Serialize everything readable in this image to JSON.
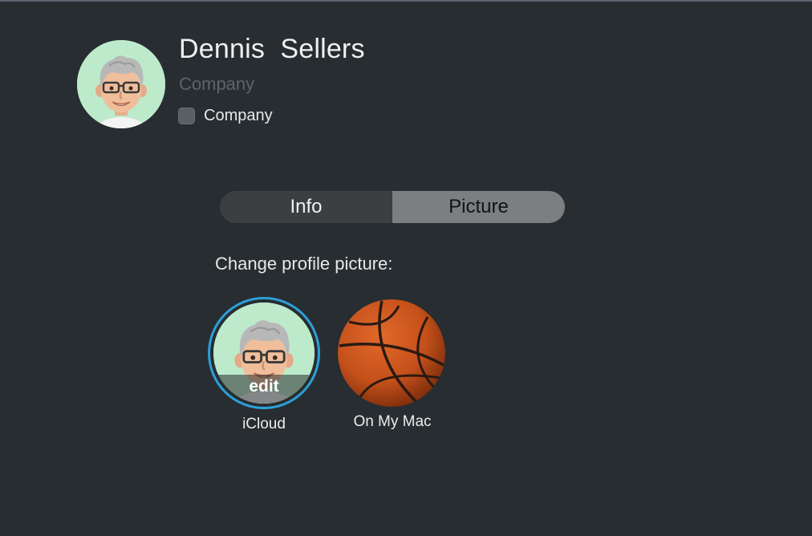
{
  "contact": {
    "first_name": "Dennis",
    "last_name": "Sellers",
    "full_name": "Dennis  Sellers",
    "company_placeholder": "Company",
    "company_checkbox_label": "Company",
    "company_checked": false
  },
  "tabs": [
    {
      "label": "Info",
      "active": false
    },
    {
      "label": "Picture",
      "active": true
    }
  ],
  "picture_panel": {
    "heading": "Change profile picture:",
    "options": [
      {
        "label": "iCloud",
        "overlay": "edit",
        "selected": true,
        "icon": "memoji-avatar"
      },
      {
        "label": "On My Mac",
        "selected": false,
        "icon": "basketball-image"
      }
    ]
  },
  "colors": {
    "background": "#272d30",
    "avatar_bg": "#bdeacb",
    "selection_ring": "#2d9fd9",
    "segment_active": "#7c7e80",
    "segment_bg": "#3b3f42"
  }
}
